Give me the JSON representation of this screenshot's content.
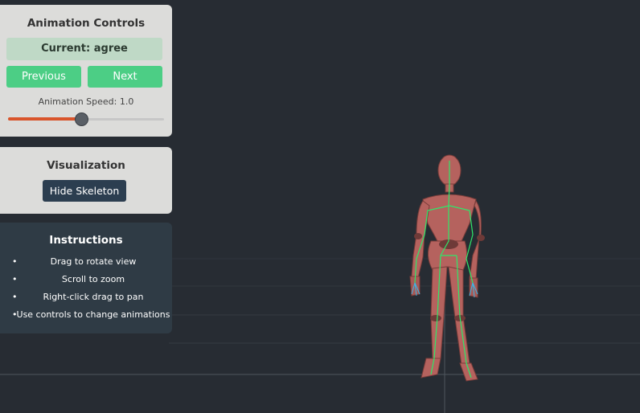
{
  "controls": {
    "title": "Animation Controls",
    "current": "Current: agree",
    "previous_label": "Previous",
    "next_label": "Next",
    "speed_label": "Animation Speed: 1.0",
    "speed_fraction": 0.47
  },
  "visualization": {
    "title": "Visualization",
    "toggle_label": "Hide Skeleton"
  },
  "instructions": {
    "title": "Instructions",
    "items": [
      "Drag to rotate view",
      "Scroll to zoom",
      "Right-click drag to pan",
      "Use controls to change animations"
    ]
  },
  "colors": {
    "background": "#272c33",
    "panel": "#dcdcda",
    "accent_green": "#4cce85",
    "slider_fill": "#d9542b",
    "dark_button": "#2c3e50",
    "figure": "#b5625e",
    "skeleton": "#2ee86a"
  },
  "icons": [
    "bullet-dot"
  ]
}
